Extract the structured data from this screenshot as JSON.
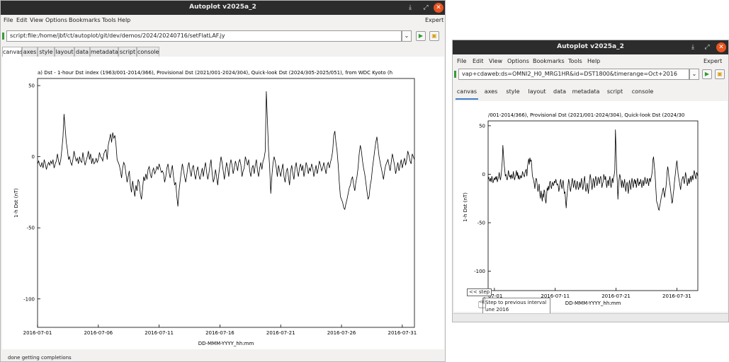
{
  "left_window": {
    "title": "Autoplot v2025a_2",
    "menu": [
      "File",
      "Edit",
      "View",
      "Options",
      "Bookmarks",
      "Tools",
      "Help"
    ],
    "expert_label": "Expert",
    "address": "script:file:/home/jbf/ct/autoplot/git/dev/demos/2024/20240716/setFlatLAF.jy",
    "tabs": [
      "canvas",
      "axes",
      "style",
      "layout",
      "data",
      "metadata",
      "script",
      "console"
    ],
    "active_tab": "canvas",
    "status": "done getting completions",
    "plot": {
      "title": "a)  Dst - 1-hour Dst index (1963/001-2014/366), Provisional Dst (2021/001-2024/304), Quick-look Dst (2024/305-2025/051), from WDC Kyoto (h",
      "ylabel": "1-h Dst (nT)",
      "xlabel": "DD-MMM-YYYY_hh:mm",
      "yticks": [
        "50",
        "0",
        "-50",
        "-100"
      ],
      "xticks": [
        "2016-07-01",
        "2016-07-06",
        "2016-07-11",
        "2016-07-16",
        "2016-07-21",
        "2016-07-26",
        "2016-07-31"
      ]
    }
  },
  "right_window": {
    "title": "Autoplot v2025a_2",
    "menu": [
      "File",
      "Edit",
      "View",
      "Options",
      "Bookmarks",
      "Tools",
      "Help"
    ],
    "expert_label": "Expert",
    "address": "vap+cdaweb:ds=OMNI2_H0_MRG1HR&id=DST1800&timerange=Oct+2016",
    "tabs": [
      "canvas",
      "axes",
      "style",
      "layout",
      "data",
      "metadata",
      "script",
      "console"
    ],
    "active_tab": "canvas",
    "plot": {
      "title": "/001-2014/366), Provisional Dst (2021/001-2024/304), Quick-look Dst (2024/30",
      "ylabel": "1-h Dst (nT)",
      "xlabel": "DD-MMM-YYYY_hh:mm",
      "yticks": [
        "50",
        "0",
        "-50",
        "-100"
      ],
      "xticks": [
        "-07-01",
        "2016-07-11",
        "2016-07-21",
        "2016-07-31"
      ]
    },
    "step_button": "<< step",
    "tooltip_line1": "Step to previous interval",
    "tooltip_line2": "une 2016"
  },
  "chart_data": {
    "type": "line",
    "x_start": "2016-07-01",
    "x_end": "2016-08-01",
    "ylim": [
      -120,
      55
    ],
    "series": [
      {
        "values": [
          -5,
          -3,
          -6,
          -7,
          -4,
          -8,
          -2,
          -5,
          -9,
          -6,
          -4,
          -6,
          -3,
          -5,
          -2,
          -8,
          -5,
          -3,
          2,
          -3,
          -6,
          -2,
          5,
          14,
          30,
          20,
          10,
          5,
          -2,
          0,
          -4,
          -6,
          -2,
          4,
          0,
          -3,
          -1,
          -5,
          0,
          -3,
          -4,
          3,
          -2,
          -6,
          -3,
          0,
          4,
          -2,
          2,
          -5,
          -1,
          -5,
          -4,
          -1,
          -4,
          -2,
          3,
          0,
          -1,
          -3,
          2,
          4,
          5,
          -2,
          8,
          12,
          16,
          10,
          17,
          13,
          15,
          8,
          -2,
          -4,
          -6,
          -10,
          -15,
          -8,
          -4,
          -6,
          -12,
          -18,
          -14,
          -10,
          -20,
          -25,
          -17,
          -22,
          -28,
          -20,
          -24,
          -16,
          -18,
          -26,
          -30,
          -23,
          -14,
          -17,
          -12,
          -16,
          -9,
          -7,
          -12,
          -15,
          -10,
          -8,
          -12,
          -10,
          -7,
          -9,
          -5,
          -8,
          -11,
          -10,
          -12,
          -18,
          -14,
          -8,
          -5,
          -11,
          -15,
          -10,
          -6,
          -14,
          -20,
          -18,
          -28,
          -35,
          -24,
          -17,
          -11,
          -5,
          -9,
          -14,
          -18,
          -13,
          -7,
          -4,
          -10,
          -14,
          -8,
          -6,
          -12,
          -16,
          -10,
          -7,
          -13,
          -16,
          -12,
          -8,
          -14,
          -8,
          -4,
          -11,
          -16,
          -12,
          -6,
          -2,
          -12,
          -18,
          -15,
          -9,
          -14,
          -20,
          -12,
          -6,
          0,
          -4,
          -10,
          -16,
          -10,
          -4,
          -8,
          -14,
          -6,
          -2,
          -6,
          -12,
          -8,
          -3,
          -6,
          -10,
          -4,
          -2,
          -6,
          -14,
          -10,
          -8,
          0,
          -3,
          -6,
          -2,
          -10,
          -14,
          -8,
          -6,
          -12,
          -6,
          -2,
          -10,
          -14,
          -8,
          -4,
          -9,
          -3,
          -1,
          4,
          46,
          25,
          4,
          -7,
          -26,
          -14,
          -5,
          0,
          -3,
          -8,
          -14,
          -6,
          -10,
          -14,
          -9,
          -5,
          -14,
          -18,
          -11,
          -8,
          -14,
          -20,
          -10,
          -6,
          -12,
          -16,
          -8,
          -4,
          -10,
          -14,
          -8,
          -5,
          -10,
          -6,
          -14,
          -10,
          -4,
          -7,
          -12,
          -8,
          -10,
          -5,
          -8,
          -14,
          -10,
          -6,
          -12,
          -8,
          -3,
          -6,
          -10,
          -8,
          -4,
          -8,
          -12,
          -6,
          -4,
          -8,
          -4,
          -1,
          4,
          15,
          18,
          10,
          4,
          -6,
          -18,
          -28,
          -30,
          -32,
          -36,
          -37,
          -33,
          -30,
          -26,
          -22,
          -20,
          -16,
          -14,
          -20,
          -24,
          -18,
          -14,
          -8,
          2,
          8,
          4,
          -3,
          -8,
          -12,
          -18,
          -24,
          -30,
          -28,
          -20,
          -16,
          -8,
          -2,
          4,
          10,
          14,
          7,
          0,
          -4,
          -8,
          -12,
          -16,
          -10,
          -6,
          -4,
          -2,
          -6,
          -10,
          -4,
          2,
          -2,
          -6,
          -12,
          -8,
          -4,
          -10,
          -6,
          -2,
          -8,
          -4,
          -1,
          -6,
          -2,
          4,
          1,
          -3,
          -5,
          2,
          0,
          -2
        ]
      }
    ]
  }
}
